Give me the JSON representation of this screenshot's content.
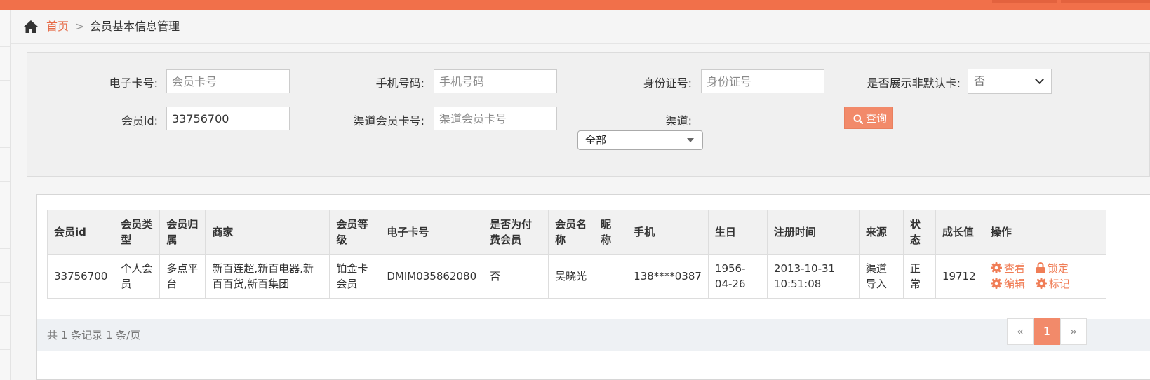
{
  "breadcrumb": {
    "home_label": "首页",
    "separator": ">",
    "current": "会员基本信息管理"
  },
  "search": {
    "card_no": {
      "label": "电子卡号:",
      "placeholder": "会员卡号",
      "value": ""
    },
    "phone": {
      "label": "手机号码:",
      "placeholder": "手机号码",
      "value": ""
    },
    "id_no": {
      "label": "身份证号:",
      "placeholder": "身份证号",
      "value": ""
    },
    "show_nondefault": {
      "label": "是否展示非默认卡:",
      "selected": "否"
    },
    "member_id": {
      "label": "会员id:",
      "placeholder": "",
      "value": "33756700"
    },
    "channel_card": {
      "label": "渠道会员卡号:",
      "placeholder": "渠道会员卡号",
      "value": ""
    },
    "channel": {
      "label": "渠道:",
      "selected": "全部"
    },
    "query_label": "查询"
  },
  "table": {
    "headers": [
      "会员id",
      "会员类型",
      "会员归属",
      "商家",
      "会员等级",
      "电子卡号",
      "是否为付费会员",
      "会员名称",
      "昵称",
      "手机",
      "生日",
      "注册时间",
      "来源",
      "状态",
      "成长值",
      "操作"
    ],
    "rows": [
      {
        "member_id": "33756700",
        "type": "个人会员",
        "belong": "多点平台",
        "merchant": "新百连超,新百电器,新百百货,新百集团",
        "level": "铂金卡会员",
        "card_no": "DMIM035862080",
        "paid": "否",
        "name": "吴晓光",
        "nickname": "",
        "phone": "138****0387",
        "birthday": "1956-04-26",
        "register_time": "2013-10-31 10:51:08",
        "source": "渠道导入",
        "status": "正常",
        "growth": "19712"
      }
    ],
    "actions": {
      "view": "查看",
      "lock": "锁定",
      "edit": "编辑",
      "mark": "标记"
    }
  },
  "pager": {
    "summary": "共 1 条记录  1 条/页",
    "prev": "«",
    "current": "1",
    "next": "»"
  },
  "colors": {
    "accent": "#f1704a",
    "link": "#e66b47",
    "button": "#f28a6a"
  },
  "icons": [
    "home-icon",
    "search-icon",
    "gear-icon",
    "lock-icon"
  ]
}
